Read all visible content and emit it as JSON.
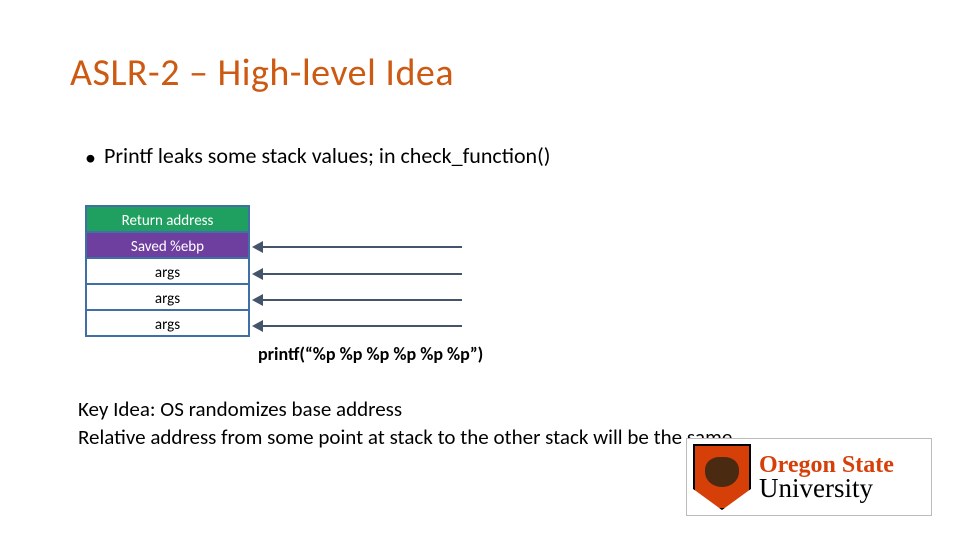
{
  "title": "ASLR-2 – High-level Idea",
  "bullet": "Printf leaks some stack values; in check_function()",
  "stack": {
    "rows": [
      {
        "label": "Return address",
        "cls": "green"
      },
      {
        "label": "Saved %ebp",
        "cls": "purple"
      },
      {
        "label": "args",
        "cls": "white"
      },
      {
        "label": "args",
        "cls": "white"
      },
      {
        "label": "args",
        "cls": "white"
      }
    ]
  },
  "printf_call": "printf(“%p %p %p %p %p %p”)",
  "key_idea_line1": "Key Idea: OS randomizes base address",
  "key_idea_line2": "Relative address from some point at stack to the other stack will be the same",
  "logo": {
    "line1": "Oregon State",
    "line2": "University"
  }
}
